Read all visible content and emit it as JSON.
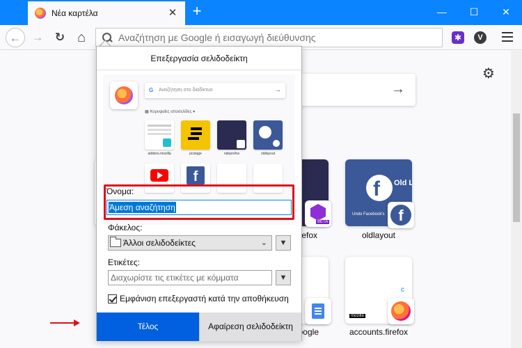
{
  "tabbar": {
    "tab_title": "Νέα καρτέλα",
    "close_glyph": "✕",
    "new_tab_glyph": "+",
    "minimize_glyph": "—",
    "maximize_glyph": "☐",
    "close_window_glyph": "✕"
  },
  "navbar": {
    "back_glyph": "←",
    "forward_glyph": "→",
    "reload_glyph": "↻",
    "home_glyph": "⌂",
    "url_placeholder": "Αναζήτηση με Google ή εισαγωγή διεύθυνσης",
    "extension_vpn_letter": "V",
    "extension_star_glyph": "✱"
  },
  "newtab": {
    "gear_glyph": "⚙",
    "search_arrow": "→",
    "tiles": [
      {
        "label": ""
      },
      {
        "label": "irefox"
      },
      {
        "label": "oldlayout"
      },
      {
        "label": "oogle"
      },
      {
        "label": "accounts.firefox"
      }
    ],
    "oldlayout_thumb_text": "Old Layou",
    "undo_facebook_text": "Undo Facebook's",
    "mozilla_tag": "mozilla",
    "beta_tag": "BETA"
  },
  "dialog": {
    "title": "Επεξεργασία σελιδοδείκτη",
    "preview": {
      "search_placeholder": "Αναζήτηση στο διαδίκτυο",
      "section_label": "Κορυφαίες ιστοσελίδες",
      "tiles": [
        "addons.mozilla",
        "pcstage",
        "ndeprofox",
        "oldlayout",
        "",
        "",
        "",
        ""
      ]
    },
    "name_label": "Όνομα:",
    "name_value": "Άμεση αναζήτηση",
    "folder_label": "Φάκελος:",
    "folder_value": "Άλλοι σελιδοδείκτες",
    "tags_label": "Ετικέτες:",
    "tags_placeholder": "Διαχωρίστε τις ετικέτες με κόμματα",
    "show_editor_label": "Εμφάνιση επεξεργαστή κατά την αποθήκευση",
    "show_editor_checked": true,
    "done_button": "Τέλος",
    "remove_button": "Αφαίρεση σελιδοδείκτη"
  },
  "colors": {
    "accent": "#0a84ff",
    "primary_button": "#0060df",
    "highlight_red": "#e0101a"
  }
}
